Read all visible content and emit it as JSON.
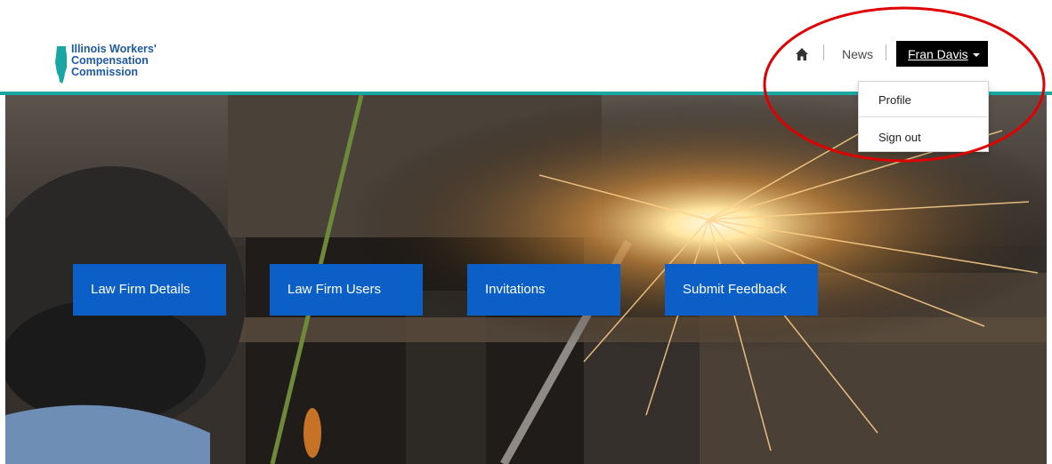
{
  "brand": {
    "lines": [
      "Illinois Workers'",
      "Compensation",
      "Commission"
    ],
    "accent_color": "#1aa6a2",
    "logo_color": "#1e5aa8"
  },
  "nav": {
    "home_icon": "home-icon",
    "news_label": "News",
    "user_name": "Fran Davis"
  },
  "user_menu": {
    "items": [
      "Profile",
      "Sign out"
    ]
  },
  "tiles": [
    {
      "label": "Law Firm Details"
    },
    {
      "label": "Law Firm Users"
    },
    {
      "label": "Invitations"
    },
    {
      "label": "Submit Feedback"
    }
  ],
  "tile_color": "#0b5fc7",
  "annotation_color": "#e00000"
}
